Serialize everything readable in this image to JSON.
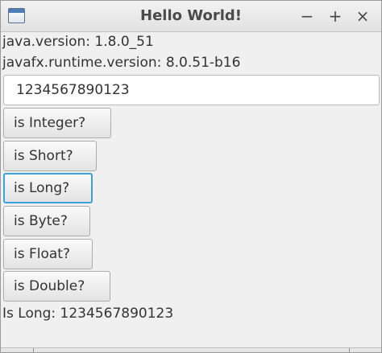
{
  "window": {
    "title": "Hello World!",
    "controls": {
      "minimize": "−",
      "maximize": "+",
      "close": "×"
    }
  },
  "info": {
    "java_version": "java.version: 1.8.0_51",
    "javafx_version": "javafx.runtime.version: 8.0.51-b16"
  },
  "input": {
    "value": "1234567890123"
  },
  "buttons": [
    {
      "label": "is Integer?"
    },
    {
      "label": "is Short?"
    },
    {
      "label": "is Long?",
      "focused": true
    },
    {
      "label": "is Byte?"
    },
    {
      "label": "is Float?"
    },
    {
      "label": "is Double?"
    }
  ],
  "result": {
    "text": "Is Long: 1234567890123"
  },
  "colors": {
    "focus_ring": "#3aa3d8",
    "background": "#f0f0f0"
  },
  "icons": {
    "app": "window-icon"
  }
}
